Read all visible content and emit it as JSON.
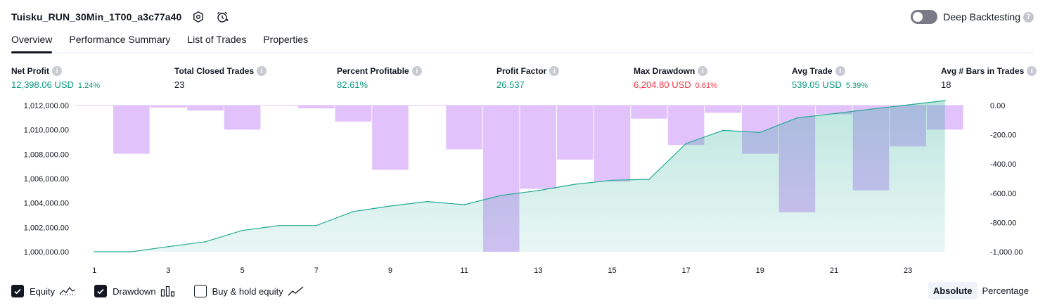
{
  "header": {
    "title": "Tuisku_RUN_30Min_1T00_a3c77a40"
  },
  "deep_backtesting": {
    "label": "Deep Backtesting",
    "help": "?"
  },
  "tabs": [
    {
      "label": "Overview"
    },
    {
      "label": "Performance Summary"
    },
    {
      "label": "List of Trades"
    },
    {
      "label": "Properties"
    }
  ],
  "metrics": {
    "net_profit": {
      "label": "Net Profit",
      "value": "12,398.06 USD",
      "pct": "1.24%"
    },
    "total_closed_trades": {
      "label": "Total Closed Trades",
      "value": "23"
    },
    "percent_profitable": {
      "label": "Percent Profitable",
      "value": "82.61%"
    },
    "profit_factor": {
      "label": "Profit Factor",
      "value": "26.537"
    },
    "max_drawdown": {
      "label": "Max Drawdown",
      "value": "6,204.80 USD",
      "pct": "0.61%"
    },
    "avg_trade": {
      "label": "Avg Trade",
      "value": "539.05 USD",
      "pct": "5.39%"
    },
    "avg_bars": {
      "label": "Avg # Bars in Trades",
      "value": "18"
    }
  },
  "colors": {
    "positive": "#089981",
    "negative": "#f23645",
    "equity_line": "#22ab94",
    "equity_fill": "#d7f0ea",
    "drawdown_fill": "#e1c2fb",
    "overlap_fill": "#b3b3ea",
    "buyhold_line": "#2962ff"
  },
  "chart_data": {
    "type": "area",
    "x_ticks": [
      "1",
      "3",
      "5",
      "7",
      "9",
      "11",
      "13",
      "15",
      "17",
      "19",
      "21",
      "23"
    ],
    "y_left_ticks": [
      "1,012,000.00",
      "1,010,000.00",
      "1,008,000.00",
      "1,006,000.00",
      "1,004,000.00",
      "1,002,000.00",
      "1,000,000.00"
    ],
    "y_right_ticks": [
      "0.00",
      "-200.00",
      "-400.00",
      "-600.00",
      "-800.00",
      "-1,000.00"
    ],
    "ylim_left": [
      1000000,
      1012000
    ],
    "ylim_right": [
      -1000,
      0
    ],
    "x": [
      1,
      2,
      3,
      4,
      5,
      6,
      7,
      8,
      9,
      10,
      11,
      12,
      13,
      14,
      15,
      16,
      17,
      18,
      19,
      20,
      21,
      22,
      23,
      24
    ],
    "series": [
      {
        "name": "Equity",
        "values": [
          1000000,
          1000000,
          1000420,
          1000820,
          1001750,
          1002150,
          1002150,
          1003300,
          1003750,
          1004120,
          1003860,
          1004620,
          1005020,
          1005540,
          1005870,
          1005940,
          1008880,
          1009960,
          1009790,
          1010980,
          1011330,
          1011700,
          1012050,
          1012400
        ]
      },
      {
        "name": "Drawdown",
        "values": [
          0,
          -330,
          -15,
          -35,
          -165,
          0,
          -20,
          -110,
          -440,
          0,
          -300,
          -1000,
          -570,
          -370,
          -520,
          -90,
          -270,
          -50,
          -330,
          -730,
          -60,
          -580,
          -280,
          -165
        ]
      }
    ]
  },
  "legend": [
    {
      "label": "Equity",
      "checked": true,
      "icon": "equity-line-icon"
    },
    {
      "label": "Drawdown",
      "checked": true,
      "icon": "drawdown-bars-icon"
    },
    {
      "label": "Buy & hold equity",
      "checked": false,
      "icon": "buyhold-line-icon"
    }
  ],
  "modes": [
    {
      "label": "Absolute",
      "active": true
    },
    {
      "label": "Percentage",
      "active": false
    }
  ]
}
